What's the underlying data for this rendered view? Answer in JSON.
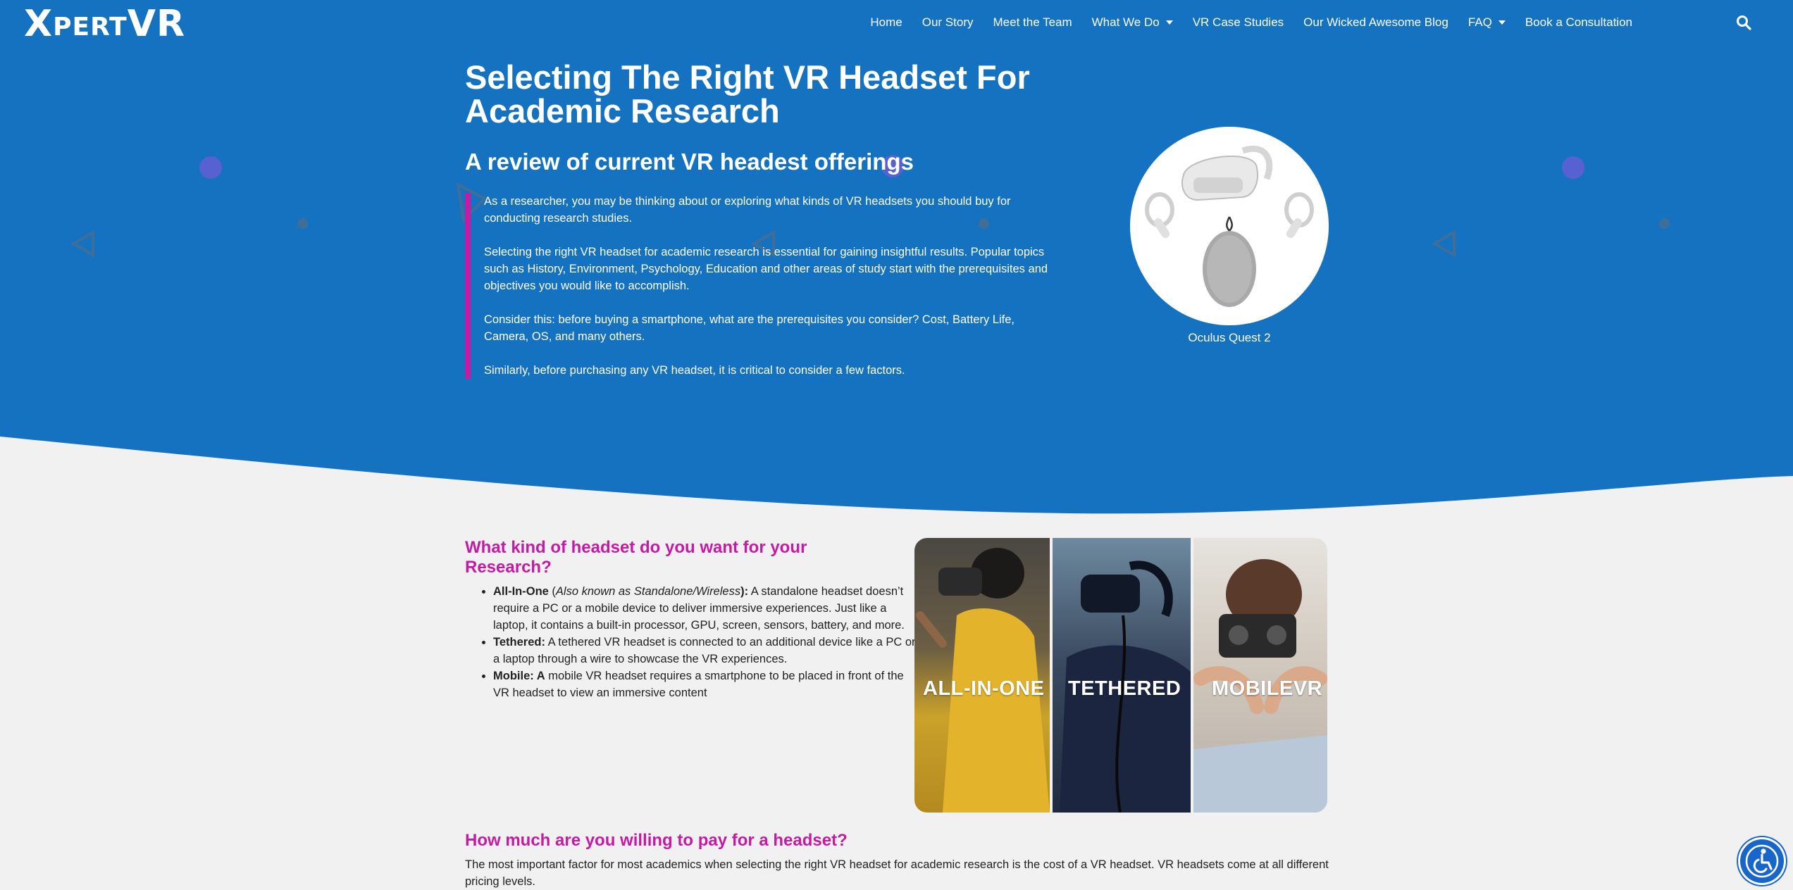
{
  "brand": {
    "logo_x": "X",
    "logo_pert": "PERT",
    "logo_vr": "VR"
  },
  "nav": {
    "items": [
      {
        "label": "Home"
      },
      {
        "label": "Our Story"
      },
      {
        "label": "Meet the Team"
      },
      {
        "label": "What We Do"
      },
      {
        "label": "VR Case Studies"
      },
      {
        "label": "Our Wicked Awesome Blog"
      },
      {
        "label": "FAQ"
      },
      {
        "label": "Book a Consultation"
      }
    ]
  },
  "hero": {
    "title": "Selecting The Right VR Headset For Academic Research",
    "subtitle": "A review of current VR headest offerings",
    "paragraphs": [
      "As a researcher, you may be thinking about or exploring what kinds of VR headsets you should buy for conducting research studies.",
      "Selecting the right VR headset for academic research is essential for gaining insightful results. Popular topics such as History, Environment, Psychology, Education and other areas of study start with the prerequisites and objectives you would like to accomplish.",
      "Consider this: before buying a smartphone, what are the prerequisites you consider? Cost, Battery Life, Camera, OS, and many others.",
      "Similarly, before purchasing any VR headset, it is critical to consider a few factors."
    ],
    "product_caption": "Oculus Quest 2"
  },
  "section_type": {
    "heading": "What kind of headset do you want for your Research?",
    "items": [
      {
        "term": "All-In-One",
        "paren_open": " (",
        "aka": "Also known as Standalone/Wireless",
        "paren_close": "):",
        "desc": " A standalone headset doesn’t require a PC or a mobile device to deliver immersive experiences. Just like a laptop, it contains a built-in processor, GPU, screen, sensors, battery, and more."
      },
      {
        "term": "Tethered:",
        "desc": " A tethered VR headset is connected to an additional device like a PC or a laptop through a wire to showcase the VR experiences."
      },
      {
        "term": "Mobile: A",
        "desc": " mobile VR headset requires a smartphone to be placed in front of the VR headset to view an immersive content"
      }
    ],
    "image_labels": [
      "ALL-IN-ONE",
      "TETHERED",
      "MOBILEVR"
    ]
  },
  "section_price": {
    "heading": "How much are you willing to pay for a headset?",
    "text": "The most important factor for most academics when selecting the right VR headset for academic research is the cost of a VR headset. VR headsets come at all different pricing levels."
  },
  "colors": {
    "hero_bg": "#1472c1",
    "accent": "#c41aa4",
    "page_bg": "#f1f1f1"
  },
  "icons": {
    "search": "search-icon",
    "accessibility": "accessibility-icon",
    "caret": "chevron-down-icon"
  }
}
